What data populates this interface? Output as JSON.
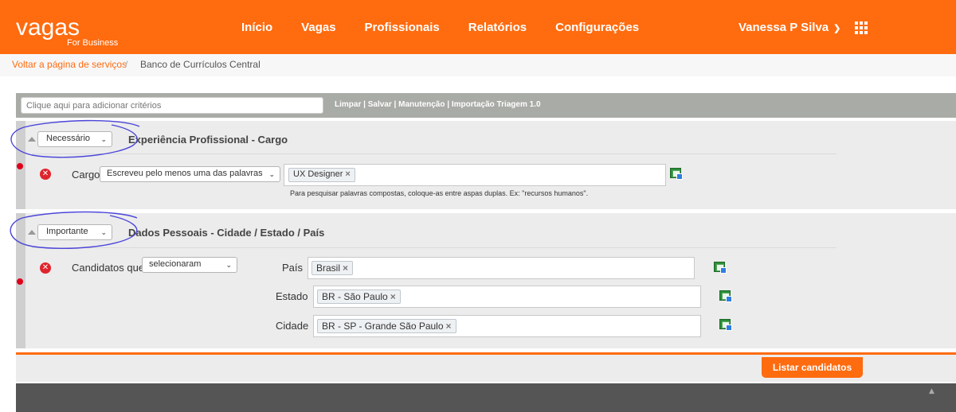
{
  "header": {
    "logo": "vagas",
    "logo_sub": "For Business",
    "nav": [
      "Início",
      "Vagas",
      "Profissionais",
      "Relatórios",
      "Configurações"
    ],
    "user_name": "Vanessa P Silva",
    "brand_color": "#ff6b0f"
  },
  "breadcrumb": {
    "link": "Voltar a página de serviços",
    "separator": "/",
    "current": "Banco de Currículos Central"
  },
  "toolbar": {
    "placeholder": "Clique aqui para adicionar critérios",
    "links": [
      "Limpar",
      "Salvar",
      "Manutenção",
      "Importação Triagem 1.0"
    ],
    "separator": "|"
  },
  "section1": {
    "priority": "Necessário",
    "title": "Experiência Profissional - Cargo",
    "field_label": "Cargo",
    "condition": "Escreveu pelo menos uma das palavras",
    "tags": [
      "UX Designer"
    ],
    "hint": "Para pesquisar palavras compostas, coloque-as entre aspas duplas. Ex: \"recursos humanos\"."
  },
  "section2": {
    "priority": "Importante",
    "title": "Dados Pessoais - Cidade / Estado / País",
    "field_label": "Candidatos que",
    "condition": "selecionaram",
    "rows": [
      {
        "label": "País",
        "tag": "Brasil"
      },
      {
        "label": "Estado",
        "tag": "BR - São Paulo"
      },
      {
        "label": "Cidade",
        "tag": "BR - SP - Grande São Paulo"
      }
    ]
  },
  "actions": {
    "list_button": "Listar candidatos"
  }
}
